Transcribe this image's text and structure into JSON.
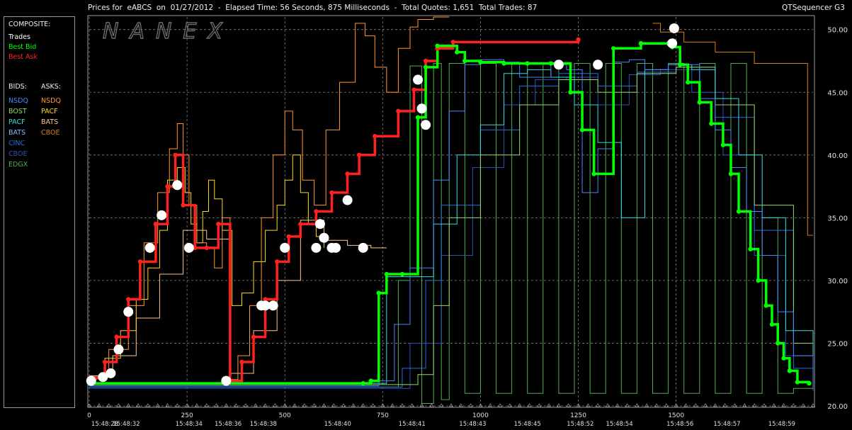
{
  "header": {
    "title": "Prices for  eABCS  on  01/27/2012  -  Elapsed Time: 56 Seconds, 875 Milliseconds  -  Total Quotes: 1,651  Total Trades: 87",
    "brand": "QTSequencer G3",
    "watermark": "NANEX"
  },
  "legend": {
    "composite_heading": "COMPOSITE:",
    "composite_items": [
      {
        "label": "Trades",
        "color": "#ffffff"
      },
      {
        "label": "Best Bid",
        "color": "#00ff00"
      },
      {
        "label": "Best Ask",
        "color": "#ff2020"
      }
    ],
    "bids_heading": "BIDS:",
    "asks_heading": "ASKS:",
    "bids": [
      {
        "label": "NSDQ",
        "color": "#4a86ff"
      },
      {
        "label": "BOST",
        "color": "#98d868"
      },
      {
        "label": "PACF",
        "color": "#30e0e0"
      },
      {
        "label": "BATS",
        "color": "#8ab8ff"
      },
      {
        "label": "CINC",
        "color": "#2070e0"
      },
      {
        "label": "CBOE",
        "color": "#3050b8"
      },
      {
        "label": "EDGX",
        "color": "#50b050"
      }
    ],
    "asks": [
      {
        "label": "NSDQ",
        "color": "#ff9830"
      },
      {
        "label": "PACF",
        "color": "#ffd820"
      },
      {
        "label": "BATS",
        "color": "#ffc890"
      },
      {
        "label": "CBOE",
        "color": "#d8801c"
      }
    ]
  },
  "chart_data": {
    "type": "line",
    "title": "",
    "xlabel": "",
    "ylabel": "",
    "xlim": [
      0,
      1850
    ],
    "ylim": [
      20,
      51
    ],
    "grid": true,
    "x_ticks": [
      0,
      250,
      500,
      750,
      1000,
      1250,
      1500
    ],
    "x_tick_labels": [
      "0",
      "250",
      "500",
      "750",
      "1000",
      "1250",
      "1500"
    ],
    "y_ticks": [
      20,
      25,
      30,
      35,
      40,
      45,
      50
    ],
    "y_tick_labels": [
      "20.00",
      "25.00",
      "30.00",
      "35.00",
      "40.00",
      "45.00",
      "50.00"
    ],
    "time_labels": [
      {
        "x": 0,
        "label": "15:48:28"
      },
      {
        "x": 95,
        "label": "15:48:32"
      },
      {
        "x": 255,
        "label": "15:48:34"
      },
      {
        "x": 355,
        "label": "15:48:36"
      },
      {
        "x": 445,
        "label": "15:48:38"
      },
      {
        "x": 635,
        "label": "15:48:40"
      },
      {
        "x": 825,
        "label": "15:48:41"
      },
      {
        "x": 980,
        "label": "15:48:43"
      },
      {
        "x": 1120,
        "label": "15:48:45"
      },
      {
        "x": 1255,
        "label": "15:48:52"
      },
      {
        "x": 1355,
        "label": "15:48:54"
      },
      {
        "x": 1510,
        "label": "15:48:56"
      },
      {
        "x": 1630,
        "label": "15:48:57"
      },
      {
        "x": 1770,
        "label": "15:48:59"
      }
    ],
    "series": [
      {
        "name": "Best Bid",
        "color": "#00ff00",
        "x": [
          0,
          700,
          720,
          740,
          760,
          800,
          840,
          860,
          890,
          940,
          960,
          1000,
          1060,
          1120,
          1180,
          1230,
          1260,
          1290,
          1340,
          1410,
          1480,
          1490,
          1510,
          1530,
          1560,
          1590,
          1620,
          1640,
          1660,
          1690,
          1710,
          1730,
          1745,
          1760,
          1775,
          1790,
          1810,
          1840
        ],
        "y": [
          21.8,
          21.8,
          22,
          29,
          30.5,
          30.5,
          43,
          47,
          48.7,
          48.2,
          47.5,
          47.4,
          47.3,
          47.3,
          47.3,
          45,
          42,
          38.5,
          48.5,
          48.9,
          48.9,
          48.6,
          47.2,
          45.8,
          44.2,
          42.5,
          40.8,
          38.5,
          35.5,
          32.5,
          30,
          28,
          26.5,
          25,
          23.8,
          22.8,
          21.9,
          21.8
        ]
      },
      {
        "name": "Best Ask",
        "color": "#ff2020",
        "x": [
          15,
          40,
          70,
          100,
          130,
          170,
          200,
          220,
          240,
          270,
          300,
          330,
          360,
          390,
          420,
          450,
          480,
          510,
          540,
          580,
          620,
          660,
          690,
          730,
          790,
          830,
          860,
          890,
          930,
          1250
        ],
        "y": [
          22.2,
          23.5,
          25.5,
          28.5,
          31.5,
          34.5,
          37.5,
          40,
          36,
          32.6,
          32.6,
          34.5,
          22,
          23.5,
          25.5,
          28.5,
          31.5,
          33.5,
          34.5,
          35.5,
          37,
          38.5,
          40,
          41.5,
          43.5,
          45.2,
          47.5,
          48.5,
          49,
          49.2
        ]
      },
      {
        "name": "NSDQ ask",
        "color": "#ff9830",
        "x": [
          0,
          50,
          100,
          140,
          175,
          205,
          225,
          240,
          255,
          275,
          300,
          320,
          340,
          360,
          380,
          410,
          440,
          470,
          500,
          520,
          545,
          575,
          605,
          640,
          680,
          705,
          730,
          760,
          790,
          820,
          840,
          880,
          920
        ],
        "y": [
          22.3,
          24.5,
          28,
          33,
          37,
          40.5,
          42.5,
          40,
          36,
          33,
          32.6,
          31,
          35,
          22.1,
          24,
          28,
          35,
          40,
          43.5,
          42,
          38,
          36,
          42,
          45.8,
          50.5,
          49.5,
          47,
          45,
          48.5,
          50.2,
          50.8,
          51,
          51
        ]
      },
      {
        "name": "PACF ask",
        "color": "#ffd820",
        "x": [
          0,
          40,
          80,
          120,
          150,
          180,
          200,
          225,
          245,
          260,
          275,
          290,
          305,
          320,
          340,
          365,
          390,
          420,
          450,
          480,
          500,
          520,
          540,
          560,
          580,
          600
        ],
        "y": [
          22.3,
          23.8,
          26,
          28.5,
          31,
          34,
          38,
          39,
          37,
          34.5,
          33,
          35.5,
          38,
          36.5,
          34,
          28,
          29,
          31.5,
          34,
          36,
          38,
          40,
          37,
          34.5,
          33.5,
          32.6
        ]
      },
      {
        "name": "NSDQ bid",
        "color": "#4a86ff",
        "x": [
          0,
          700,
          740,
          780,
          820,
          880,
          920,
          960,
          1000,
          1060,
          1100,
          1140,
          1180,
          1220,
          1260,
          1300,
          1340,
          1380,
          1420,
          1480,
          1520,
          1560,
          1600,
          1640,
          1680,
          1720,
          1760,
          1800,
          1850
        ],
        "y": [
          21.6,
          21.6,
          22,
          26.5,
          31,
          38,
          43.5,
          47.2,
          47.6,
          47.4,
          46.2,
          46.2,
          47.2,
          46.8,
          37,
          40.5,
          47.4,
          47.6,
          46.8,
          47.2,
          47.2,
          44.5,
          42,
          39,
          35.5,
          32,
          27.5,
          24,
          21.3
        ]
      },
      {
        "name": "PACF bid",
        "color": "#30e0e0",
        "x": [
          0,
          720,
          760,
          800,
          880,
          940,
          1000,
          1060,
          1120,
          1180,
          1240,
          1300,
          1360,
          1420,
          1480,
          1540,
          1600,
          1660,
          1720,
          1780,
          1850
        ],
        "y": [
          21.8,
          21.8,
          30.3,
          30.3,
          34.5,
          40,
          42.4,
          46.5,
          46.8,
          46.2,
          44,
          41,
          35,
          46.8,
          47.2,
          46.8,
          44.5,
          40,
          35,
          26,
          21.6
        ]
      },
      {
        "name": "EDGX bid",
        "color": "#50b050",
        "x": [
          0,
          760,
          790,
          820,
          850,
          880,
          900,
          920,
          960,
          1000,
          1040,
          1080,
          1120,
          1160,
          1200,
          1240,
          1280,
          1320,
          1360,
          1400,
          1440,
          1480,
          1520,
          1560,
          1600,
          1640,
          1680,
          1720,
          1760,
          1800,
          1850
        ],
        "y": [
          21.5,
          21.5,
          30,
          47.1,
          20.2,
          47.3,
          20.5,
          47.3,
          21,
          47.3,
          21,
          47.3,
          21,
          47.3,
          21,
          47.3,
          21,
          47.3,
          21,
          47.3,
          21,
          47.3,
          21,
          47.3,
          21,
          47.3,
          21,
          35,
          21,
          21.4,
          21.3
        ]
      },
      {
        "name": "CBOE ask",
        "color": "#d8801c",
        "x": [
          1440,
          1460,
          1520,
          1600,
          1700,
          1780,
          1820,
          1836,
          1850
        ],
        "y": [
          50.5,
          49.8,
          49,
          48.2,
          47.3,
          47.3,
          47.3,
          33.6,
          33.6
        ]
      },
      {
        "name": "BATS ask",
        "color": "#ffc890",
        "x": [
          0,
          60,
          120,
          180,
          240,
          300,
          360,
          420,
          480,
          540,
          600,
          660,
          720,
          760
        ],
        "y": [
          22.4,
          24,
          27,
          30.5,
          34,
          33.3,
          22.6,
          26,
          30,
          34.8,
          33.2,
          32.8,
          32.6,
          32.6
        ]
      },
      {
        "name": "BOST bid",
        "color": "#98d868",
        "x": [
          0,
          800,
          840,
          880,
          920,
          1000,
          1100,
          1200,
          1300,
          1400,
          1500,
          1600,
          1700,
          1800,
          1850
        ],
        "y": [
          21.7,
          21.7,
          22.5,
          28,
          35,
          40,
          44,
          46,
          45,
          46.5,
          47,
          44,
          36,
          25,
          21.6
        ]
      },
      {
        "name": "CINC bid",
        "color": "#2070e0",
        "x": [
          0,
          760,
          800,
          860,
          900,
          1000,
          1100,
          1200,
          1300,
          1400,
          1500,
          1600,
          1700,
          1800,
          1850
        ],
        "y": [
          21.5,
          21.5,
          23,
          30,
          36,
          42,
          45.5,
          46.5,
          45.5,
          46.6,
          47,
          43,
          34,
          23,
          21.4
        ]
      },
      {
        "name": "CBOE bid",
        "color": "#3050b8",
        "x": [
          0,
          780,
          820,
          900,
          980,
          1060,
          1140,
          1220,
          1300,
          1380,
          1460,
          1540,
          1620,
          1700,
          1780,
          1850
        ],
        "y": [
          21.4,
          21.4,
          25,
          32,
          39,
          44,
          46,
          46.2,
          44,
          46.4,
          46.8,
          45,
          40,
          32,
          24,
          21.2
        ]
      }
    ],
    "trades": {
      "name": "Trades",
      "color": "#ffffff",
      "x": [
        5,
        35,
        55,
        75,
        100,
        155,
        185,
        225,
        255,
        350,
        440,
        450,
        470,
        500,
        580,
        590,
        600,
        620,
        630,
        660,
        700,
        840,
        850,
        860,
        1200,
        1300,
        1490,
        1495
      ],
      "y": [
        22,
        22.3,
        22.6,
        24.5,
        27.5,
        32.6,
        35.2,
        37.6,
        32.6,
        22,
        28,
        28,
        28,
        32.6,
        32.6,
        34.5,
        33.4,
        32.6,
        32.6,
        36.4,
        32.6,
        46,
        43.7,
        42.4,
        47.2,
        47.2,
        48.9,
        50.1
      ]
    }
  }
}
